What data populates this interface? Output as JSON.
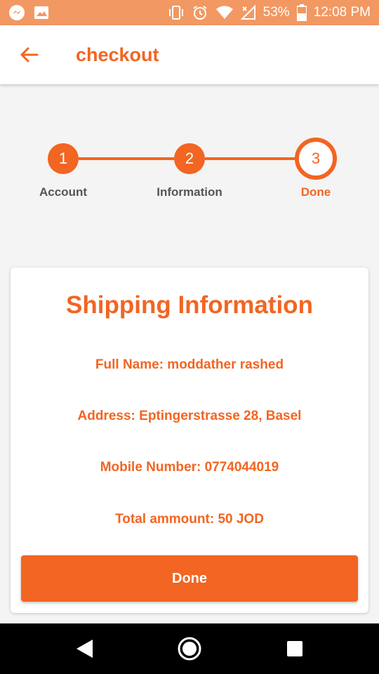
{
  "status_bar": {
    "battery": "53%",
    "time": "12:08 PM",
    "left_icons": [
      "messenger-icon",
      "image-icon"
    ],
    "right_icons": [
      "vibrate-icon",
      "alarm-icon",
      "wifi-icon",
      "signal-icon",
      "battery-icon"
    ]
  },
  "app_bar": {
    "title": "checkout"
  },
  "stepper": {
    "steps": [
      {
        "number": "1",
        "label": "Account",
        "state": "completed"
      },
      {
        "number": "2",
        "label": "Information",
        "state": "completed"
      },
      {
        "number": "3",
        "label": "Done",
        "state": "active"
      }
    ]
  },
  "card": {
    "title": "Shipping Information",
    "full_name": "Full Name: moddather rashed",
    "address": "Address: Eptingerstrasse 28, Basel",
    "mobile": "Mobile Number: 0774044019",
    "total": "Total ammount: 50 JOD",
    "done_button": "Done"
  },
  "colors": {
    "accent": "#f26522",
    "status_bar": "#f29862",
    "nav_bar": "#000000"
  }
}
